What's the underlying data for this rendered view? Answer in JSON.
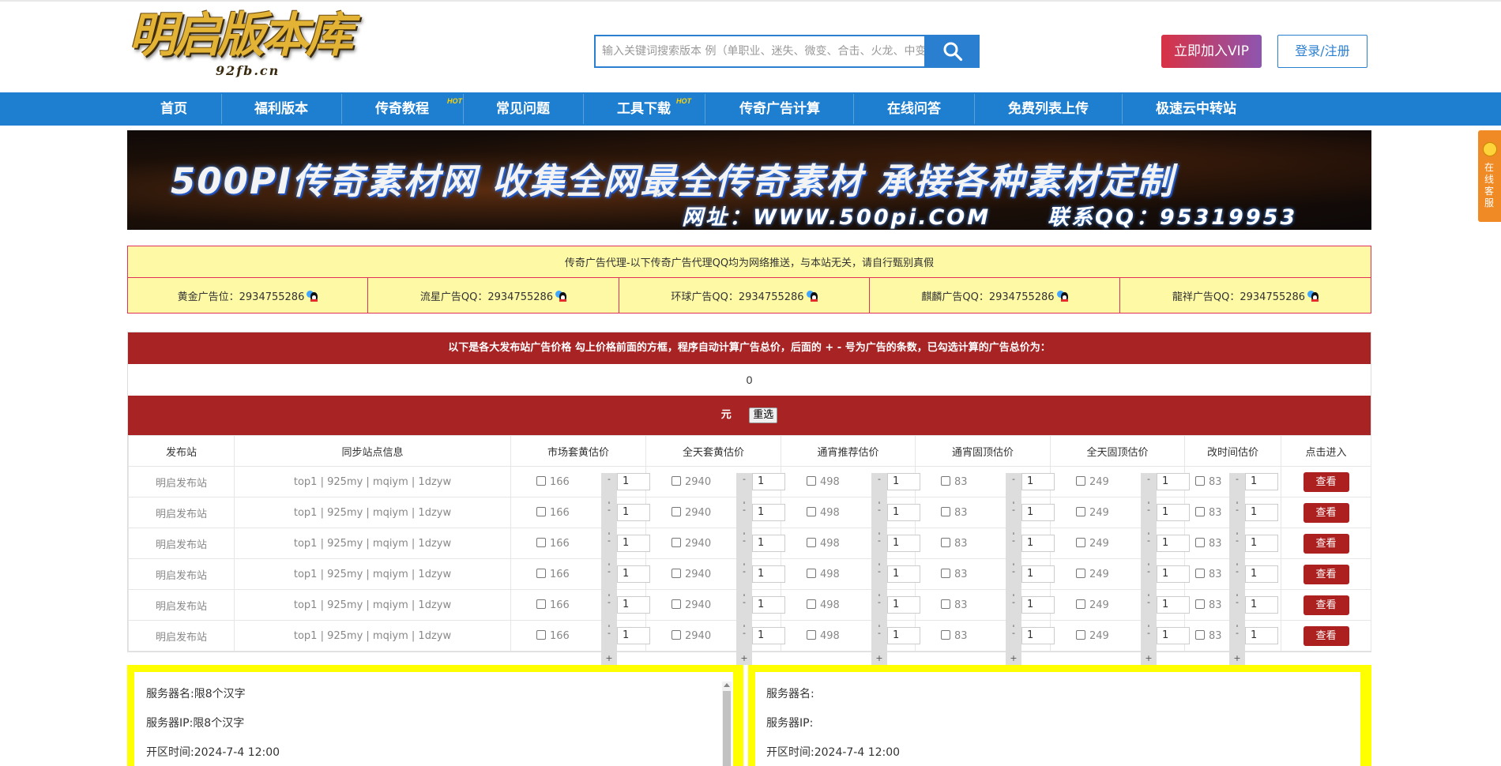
{
  "header": {
    "logo_text": "明启版本库",
    "logo_sub": "92fb.cn",
    "search_placeholder": "输入关键词搜索版本 例（单职业、迷失、微变、合击、火龙、中变",
    "vip_label": "立即加入VIP",
    "login_label": "登录/注册"
  },
  "nav": {
    "items": [
      {
        "label": "首页"
      },
      {
        "label": "福利版本"
      },
      {
        "label": "传奇教程",
        "badge": "HOT"
      },
      {
        "label": "常见问题"
      },
      {
        "label": "工具下载",
        "badge": "HOT"
      },
      {
        "label": "传奇广告计算"
      },
      {
        "label": "在线问答"
      },
      {
        "label": "免费列表上传"
      },
      {
        "label": "极速云中转站"
      }
    ]
  },
  "banner": {
    "line1": "500PI传奇素材网 收集全网最全传奇素材 承接各种素材定制",
    "line2": "网址：WWW.500pi.COM",
    "line3": "联系QQ：95319953"
  },
  "side_tab": {
    "label": "在线客服"
  },
  "ad_agents": {
    "title": "传奇广告代理-以下传奇广告代理QQ均为网络推送，与本站无关，请自行甄别真假",
    "items": [
      {
        "label": "黄金广告位：2934755286"
      },
      {
        "label": "流星广告QQ：2934755286"
      },
      {
        "label": "环球广告QQ：2934755286"
      },
      {
        "label": "麒麟广告QQ：2934755286"
      },
      {
        "label": "龍祥广告QQ：2934755286"
      }
    ]
  },
  "calc": {
    "heading": "以下是各大发布站广告价格 勾上价格前面的方框，程序自动计算广告总价，后面的 + - 号为广告的条数，已勾选计算的广告总价为：",
    "total": "0",
    "unit": "元",
    "reset_label": "重选",
    "columns": [
      "发布站",
      "同步站点信息",
      "市场套黄估价",
      "全天套黄估价",
      "通宵推荐估价",
      "通宵固顶估价",
      "全天固顶估价",
      "改时间估价",
      "点击进入"
    ],
    "stepper_minus": "-",
    "stepper_plus": "+",
    "rows": [
      {
        "site": "明启发布站",
        "sync": "top1 | 925my | mqiym | 1dzyw",
        "prices": [
          "166",
          "2940",
          "498",
          "83",
          "249",
          "83"
        ],
        "qty": [
          "1",
          "1",
          "1",
          "1",
          "1",
          "1"
        ],
        "action": "查看"
      },
      {
        "site": "明启发布站",
        "sync": "top1 | 925my | mqiym | 1dzyw",
        "prices": [
          "166",
          "2940",
          "498",
          "83",
          "249",
          "83"
        ],
        "qty": [
          "1",
          "1",
          "1",
          "1",
          "1",
          "1"
        ],
        "action": "查看"
      },
      {
        "site": "明启发布站",
        "sync": "top1 | 925my | mqiym | 1dzyw",
        "prices": [
          "166",
          "2940",
          "498",
          "83",
          "249",
          "83"
        ],
        "qty": [
          "1",
          "1",
          "1",
          "1",
          "1",
          "1"
        ],
        "action": "查看"
      },
      {
        "site": "明启发布站",
        "sync": "top1 | 925my | mqiym | 1dzyw",
        "prices": [
          "166",
          "2940",
          "498",
          "83",
          "249",
          "83"
        ],
        "qty": [
          "1",
          "1",
          "1",
          "1",
          "1",
          "1"
        ],
        "action": "查看"
      },
      {
        "site": "明启发布站",
        "sync": "top1 | 925my | mqiym | 1dzyw",
        "prices": [
          "166",
          "2940",
          "498",
          "83",
          "249",
          "83"
        ],
        "qty": [
          "1",
          "1",
          "1",
          "1",
          "1",
          "1"
        ],
        "action": "查看"
      },
      {
        "site": "明启发布站",
        "sync": "top1 | 925my | mqiym | 1dzyw",
        "prices": [
          "166",
          "2940",
          "498",
          "83",
          "249",
          "83"
        ],
        "qty": [
          "1",
          "1",
          "1",
          "1",
          "1",
          "1"
        ],
        "action": "查看"
      }
    ]
  },
  "server_input": {
    "lines": [
      "服务器名:限8个汉字",
      "服务器IP:限8个汉字",
      "开区时间:2024-7-4 12:00"
    ]
  },
  "server_preview": {
    "lines": [
      "服务器名:",
      "服务器IP:",
      "开区时间:2024-7-4 12:00"
    ]
  },
  "colors": {
    "nav_blue": "#1e7fd0",
    "calc_red": "#a82324",
    "ad_yellow": "#fdf9a5",
    "panel_yellow": "#ffff00",
    "vip_gradient_start": "#d83245",
    "vip_gradient_end": "#8e55b0"
  }
}
